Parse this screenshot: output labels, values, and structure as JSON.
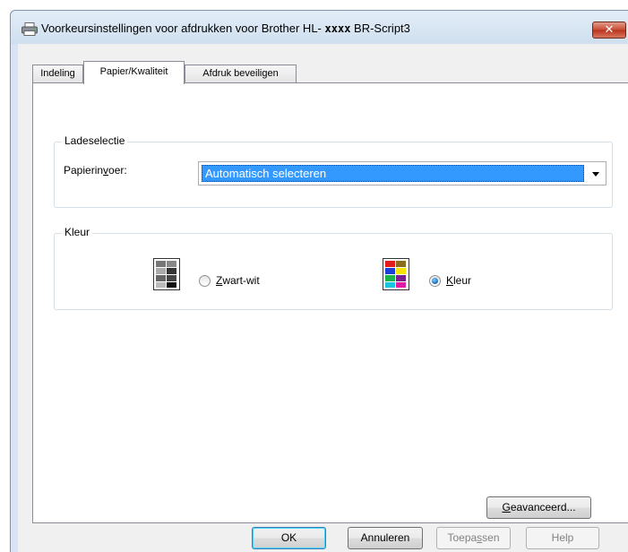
{
  "window": {
    "title_prefix": "Voorkeursinstellingen voor afdrukken voor Brother HL-",
    "title_model": "xxxx",
    "title_suffix": "BR-Script3",
    "close_label": "✕"
  },
  "tabs": [
    {
      "label": "Indeling",
      "active": false
    },
    {
      "label": "Papier/Kwaliteit",
      "active": true
    },
    {
      "label": "Afdruk beveiligen",
      "active": false
    }
  ],
  "tray_group": {
    "title": "Ladeselectie",
    "field_label_pre": "Papierin",
    "field_label_mnemonic": "v",
    "field_label_post": "oer:",
    "selected_value": "Automatisch selecteren"
  },
  "color_group": {
    "title": "Kleur",
    "bw_option": {
      "mnemonic": "Z",
      "rest": "wart-wit",
      "checked": false,
      "icon": "grayscale-document-icon"
    },
    "color_option": {
      "mnemonic": "K",
      "rest": "leur",
      "checked": true,
      "icon": "color-document-icon"
    }
  },
  "advanced_button": {
    "mnemonic": "G",
    "rest": "eavanceerd..."
  },
  "footer": {
    "ok": "OK",
    "cancel": "Annuleren",
    "apply_pre": "Toepa",
    "apply_mnemonic": "s",
    "apply_post": "sen",
    "help": "Help"
  }
}
